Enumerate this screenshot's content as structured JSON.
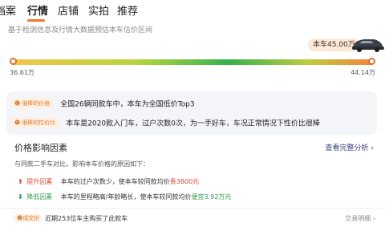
{
  "tabs": [
    {
      "label": "档案"
    },
    {
      "label": "行情"
    },
    {
      "label": "店铺"
    },
    {
      "label": "实拍"
    },
    {
      "label": "推荐"
    }
  ],
  "subtitle": "基于检测信息及行情大数据预估本车估价区间",
  "price": {
    "label": "本车45.00万"
  },
  "gauge": {
    "min_label": "36.61万",
    "max_label": "44.14万",
    "min": 36.61,
    "max": 44.14
  },
  "advantages": [
    {
      "tag": "很棒的价格",
      "text": "全国26辆同款车中，本车为全国低价Top3"
    },
    {
      "tag": "很棒的性价比",
      "text": "本车是2020款入门车，过户次数0次，为一手好车，车况正常情况下性价比很棒"
    }
  ],
  "factors": {
    "title": "价格影响因素",
    "link": "查看完整分析 ›",
    "description": "与同款二手车对比，影响本车价格的原因如下：",
    "up": {
      "label": "提升因素",
      "text": "本车的过户次数少，使本车较同款均价",
      "value": "贵3800元"
    },
    "down": {
      "label": "降低因素",
      "text": "本车的里程略高/年龄略长，使本车较同款均价",
      "value": "便宜3.92万元"
    }
  },
  "trade": {
    "badge": "成交价",
    "text": "近期253位车主购买了此款车",
    "link": "交易明细 ›"
  },
  "colors": {
    "accent": "#f07a2a",
    "up": "#d84a35",
    "down": "#2f9c4a"
  }
}
